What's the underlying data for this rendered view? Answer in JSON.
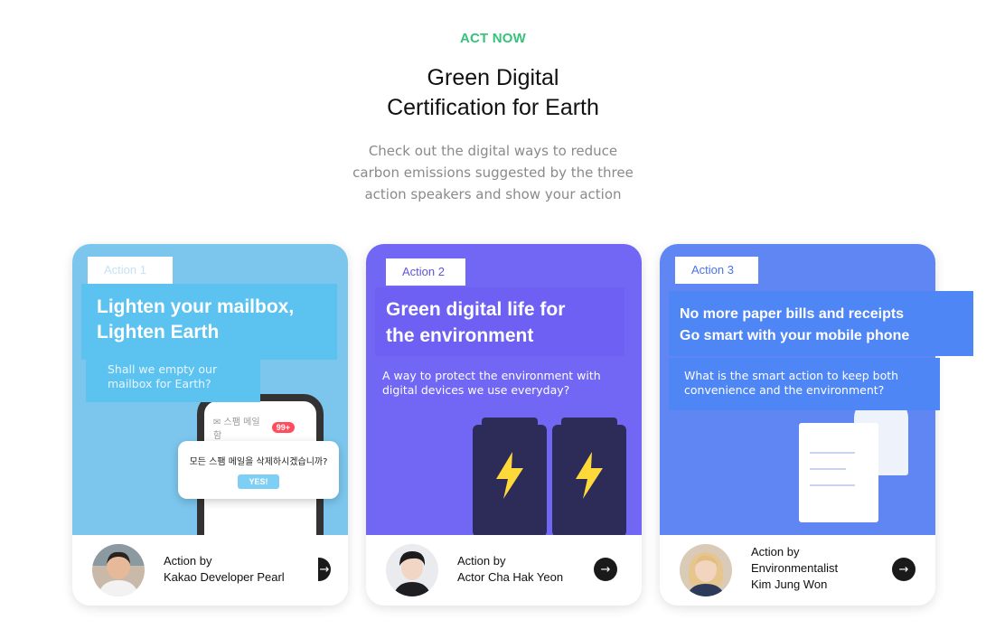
{
  "header": {
    "eyebrow": "ACT NOW",
    "title_line1": "Green Digital",
    "title_line2": "Certification for Earth",
    "subtitle_line1": "Check out the digital ways to reduce",
    "subtitle_line2": "carbon emissions suggested by the three",
    "subtitle_line3": "action speakers and show your action"
  },
  "cards": [
    {
      "tag": "Action 1",
      "headline_line1": "Lighten your mailbox,",
      "headline_line2": "Lighten Earth",
      "desc_line1": "Shall we empty our",
      "desc_line2": "mailbox for Earth?",
      "illustration": {
        "mail_label": "✉ 스팸 메일함",
        "mail_count": "99+",
        "dialog_text": "모든 스팸 메일을 삭제하시겠습니까?",
        "dialog_button": "YES!"
      },
      "credit_line1": "Action by",
      "credit_line2": "Kakao Developer  Pearl",
      "arrow": "→"
    },
    {
      "tag": "Action 2",
      "headline_line1": "Green digital life for",
      "headline_line2": "the environment",
      "desc_line1": "A way to protect the environment with",
      "desc_line2": "digital devices we use everyday?",
      "credit_line1": "Action by",
      "credit_line2": "Actor Cha Hak Yeon",
      "arrow": "→"
    },
    {
      "tag": "Action 3",
      "headline_line1": "No more paper bills and receipts",
      "headline_line2": "Go smart with your mobile phone",
      "desc_line1": "What is the smart action to keep both",
      "desc_line2": "convenience and the environment?",
      "credit_line1": "Action by",
      "credit_line2": "Environmentalist",
      "credit_line3": "Kim Jung Won",
      "arrow": "→"
    }
  ],
  "colors": {
    "accent_green": "#35c27a",
    "card1_bg": "#7cc6ee",
    "card2_bg": "#7266f4",
    "card3_bg": "#5f86f3",
    "lightning": "#ffd83a"
  }
}
